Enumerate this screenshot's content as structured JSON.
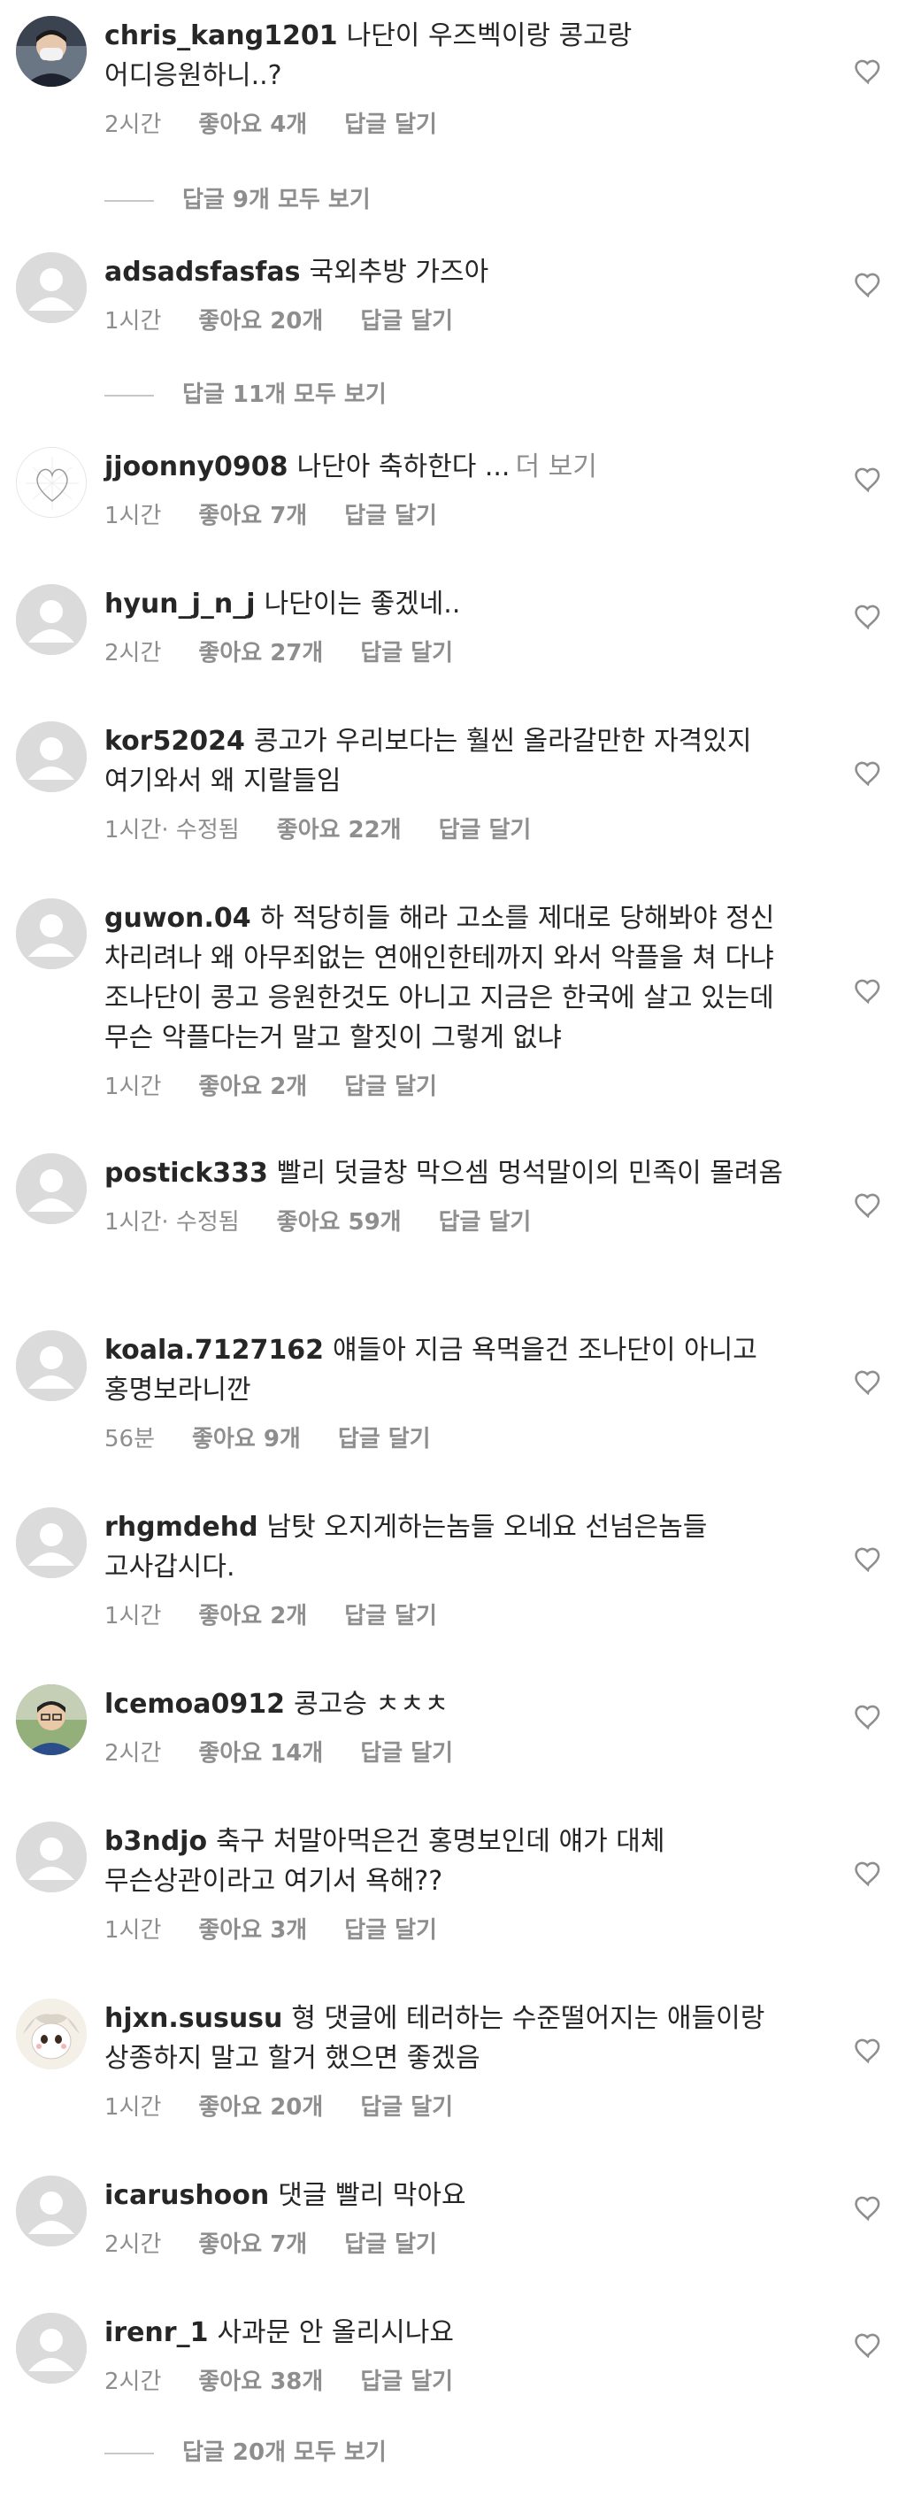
{
  "comments": [
    {
      "username": "chris_kang1201",
      "text": "나단이 우즈벡이랑 콩고랑 어디응원하니..?",
      "time": "2시간",
      "likes": "좋아요 4개",
      "reply": "답글 달기",
      "avatar": "photo-man-mask-icon"
    },
    {
      "username": "adsadsfasfas",
      "text": "국외추방 가즈아",
      "time": "1시간",
      "likes": "좋아요 20개",
      "reply": "답글 달기",
      "avatar": "default-user-icon"
    },
    {
      "username": "jjoonny0908",
      "text": "나단아 축하한다 ...",
      "more": "더 보기",
      "time": "1시간",
      "likes": "좋아요 7개",
      "reply": "답글 달기",
      "avatar": "heart-sketch-icon"
    },
    {
      "username": "hyun_j_n_j",
      "text": "나단이는 좋겠네..",
      "time": "2시간",
      "likes": "좋아요 27개",
      "reply": "답글 달기",
      "avatar": "default-user-icon"
    },
    {
      "username": "kor52024",
      "text": "콩고가 우리보다는 훨씬 올라갈만한 자격있지 여기와서 왜 지랄들임",
      "time": "1시간· 수정됨",
      "likes": "좋아요 22개",
      "reply": "답글 달기",
      "avatar": "default-user-icon"
    },
    {
      "username": "guwon.04",
      "text": "하 적당히들 해라 고소를 제대로 당해봐야 정신 차리려나 왜 아무죄없는 연애인한테까지 와서 악플을 쳐 다냐 조나단이 콩고 응원한것도 아니고 지금은 한국에 살고 있는데 무슨 악플다는거 말고 할짓이 그렇게 없냐",
      "time": "1시간",
      "likes": "좋아요 2개",
      "reply": "답글 달기",
      "avatar": "default-user-icon"
    },
    {
      "username": "postick333",
      "text": "빨리 덧글창 막으셈 멍석말이의 민족이 몰려옴",
      "time": "1시간· 수정됨",
      "likes": "좋아요 59개",
      "reply": "답글 달기",
      "avatar": "default-user-icon"
    },
    {
      "username": "koala.7127162",
      "text": "얘들아 지금 욕먹을건 조나단이 아니고 홍명보라니깐",
      "time": "56분",
      "likes": "좋아요 9개",
      "reply": "답글 달기",
      "avatar": "default-user-icon"
    },
    {
      "username": "rhgmdehd",
      "text": "남탓 오지게하는놈들 오네요 선넘은놈들 고사갑시다.",
      "time": "1시간",
      "likes": "좋아요 2개",
      "reply": "답글 달기",
      "avatar": "default-user-icon"
    },
    {
      "username": "lcemoa0912",
      "text": "콩고승 ㅊㅊㅊ",
      "time": "2시간",
      "likes": "좋아요 14개",
      "reply": "답글 달기",
      "avatar": "photo-man-glasses-icon"
    },
    {
      "username": "b3ndjo",
      "text": "축구 처말아먹은건 홍명보인데 얘가 대체 무슨상관이라고 여기서 욕해??",
      "time": "1시간",
      "likes": "좋아요 3개",
      "reply": "답글 달기",
      "avatar": "default-user-icon"
    },
    {
      "username": "hjxn.sususu",
      "text": "형 댓글에 테러하는 수준떨어지는 애들이랑 상종하지 말고 할거 했으면 좋겠음",
      "time": "1시간",
      "likes": "좋아요 20개",
      "reply": "답글 달기",
      "avatar": "cartoon-character-icon"
    },
    {
      "username": "icarushoon",
      "text": "댓글 빨리 막아요",
      "time": "2시간",
      "likes": "좋아요 7개",
      "reply": "답글 달기",
      "avatar": "default-user-icon"
    },
    {
      "username": "irenr_1",
      "text": "사과문 안 올리시나요",
      "time": "2시간",
      "likes": "좋아요 38개",
      "reply": "답글 달기",
      "avatar": "default-user-icon"
    }
  ],
  "view_replies": [
    {
      "label": "답글 9개 모두 보기"
    },
    {
      "label": "답글 11개 모두 보기"
    },
    {
      "label": "답글 20개 모두 보기"
    }
  ]
}
